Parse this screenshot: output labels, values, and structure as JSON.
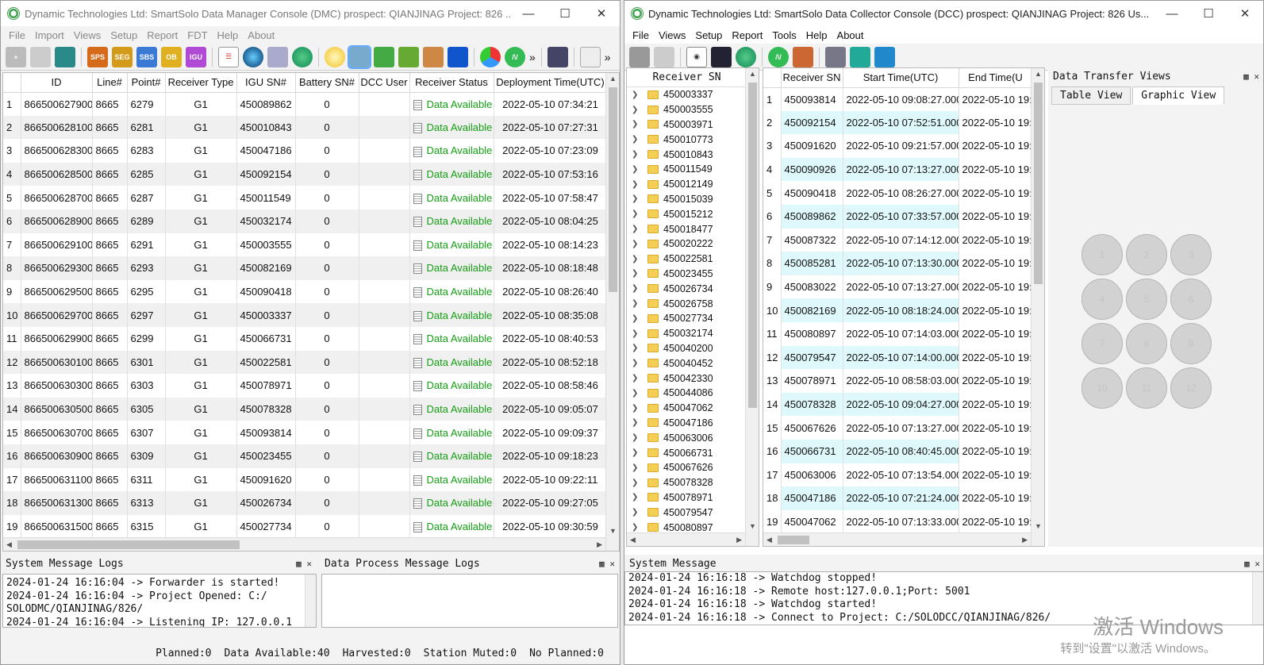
{
  "dmc": {
    "title": "Dynamic Technologies Ltd: SmartSolo Data Manager Console (DMC) prospect: QIANJINAG  Project: 826  ...",
    "menu": [
      "File",
      "Import",
      "Views",
      "Setup",
      "Report",
      "FDT",
      "Help",
      "About"
    ],
    "toolbar_labels": [
      "SPS",
      "SEG",
      "SBS",
      "OB",
      "IGU"
    ],
    "columns": [
      "ID",
      "Line#",
      "Point#",
      "Receiver Type",
      "IGU SN#",
      "Battery SN#",
      "DCC User",
      "Receiver Status",
      "Deployment Time(UTC)"
    ],
    "rows": [
      [
        "1",
        "866500627900",
        "8665",
        "6279",
        "G1",
        "450089862",
        "0",
        "",
        "Data Available",
        "2022-05-10 07:34:21"
      ],
      [
        "2",
        "866500628100",
        "8665",
        "6281",
        "G1",
        "450010843",
        "0",
        "",
        "Data Available",
        "2022-05-10 07:27:31"
      ],
      [
        "3",
        "866500628300",
        "8665",
        "6283",
        "G1",
        "450047186",
        "0",
        "",
        "Data Available",
        "2022-05-10 07:23:09"
      ],
      [
        "4",
        "866500628500",
        "8665",
        "6285",
        "G1",
        "450092154",
        "0",
        "",
        "Data Available",
        "2022-05-10 07:53:16"
      ],
      [
        "5",
        "866500628700",
        "8665",
        "6287",
        "G1",
        "450011549",
        "0",
        "",
        "Data Available",
        "2022-05-10 07:58:47"
      ],
      [
        "6",
        "866500628900",
        "8665",
        "6289",
        "G1",
        "450032174",
        "0",
        "",
        "Data Available",
        "2022-05-10 08:04:25"
      ],
      [
        "7",
        "866500629100",
        "8665",
        "6291",
        "G1",
        "450003555",
        "0",
        "",
        "Data Available",
        "2022-05-10 08:14:23"
      ],
      [
        "8",
        "866500629300",
        "8665",
        "6293",
        "G1",
        "450082169",
        "0",
        "",
        "Data Available",
        "2022-05-10 08:18:48"
      ],
      [
        "9",
        "866500629500",
        "8665",
        "6295",
        "G1",
        "450090418",
        "0",
        "",
        "Data Available",
        "2022-05-10 08:26:40"
      ],
      [
        "10",
        "866500629700",
        "8665",
        "6297",
        "G1",
        "450003337",
        "0",
        "",
        "Data Available",
        "2022-05-10 08:35:08"
      ],
      [
        "11",
        "866500629900",
        "8665",
        "6299",
        "G1",
        "450066731",
        "0",
        "",
        "Data Available",
        "2022-05-10 08:40:53"
      ],
      [
        "12",
        "866500630100",
        "8665",
        "6301",
        "G1",
        "450022581",
        "0",
        "",
        "Data Available",
        "2022-05-10 08:52:18"
      ],
      [
        "13",
        "866500630300",
        "8665",
        "6303",
        "G1",
        "450078971",
        "0",
        "",
        "Data Available",
        "2022-05-10 08:58:46"
      ],
      [
        "14",
        "866500630500",
        "8665",
        "6305",
        "G1",
        "450078328",
        "0",
        "",
        "Data Available",
        "2022-05-10 09:05:07"
      ],
      [
        "15",
        "866500630700",
        "8665",
        "6307",
        "G1",
        "450093814",
        "0",
        "",
        "Data Available",
        "2022-05-10 09:09:37"
      ],
      [
        "16",
        "866500630900",
        "8665",
        "6309",
        "G1",
        "450023455",
        "0",
        "",
        "Data Available",
        "2022-05-10 09:18:23"
      ],
      [
        "17",
        "866500631100",
        "8665",
        "6311",
        "G1",
        "450091620",
        "0",
        "",
        "Data Available",
        "2022-05-10 09:22:11"
      ],
      [
        "18",
        "866500631300",
        "8665",
        "6313",
        "G1",
        "450026734",
        "0",
        "",
        "Data Available",
        "2022-05-10 09:27:05"
      ],
      [
        "19",
        "866500631500",
        "8665",
        "6315",
        "G1",
        "450027734",
        "0",
        "",
        "Data Available",
        "2022-05-10 09:30:59"
      ]
    ],
    "system_log_title": "System Message Logs",
    "process_log_title": "Data Process Message Logs",
    "system_log": [
      "2024-01-24 16:16:04 -> Forwarder is started!",
      "2024-01-24 16:16:04 -> Project Opened: C:/",
      "SOLODMC/QIANJINAG/826/",
      "2024-01-24 16:16:04 -> Listening IP: 127.0.0.1"
    ],
    "status": [
      "Planned:0",
      "Data Available:40",
      "Harvested:0",
      "Station Muted:0",
      "No Planned:0"
    ]
  },
  "dcc": {
    "title": "Dynamic Technologies Ltd: SmartSolo Data Collector Console (DCC) prospect: QIANJINAG  Project: 826  Us...",
    "menu": [
      "File",
      "Views",
      "Setup",
      "Report",
      "Tools",
      "Help",
      "About"
    ],
    "tree_header": "Receiver SN",
    "tree": [
      "450003337",
      "450003555",
      "450003971",
      "450010773",
      "450010843",
      "450011549",
      "450012149",
      "450015039",
      "450015212",
      "450018477",
      "450020222",
      "450022581",
      "450023455",
      "450026734",
      "450026758",
      "450027734",
      "450032174",
      "450040200",
      "450040452",
      "450042330",
      "450044086",
      "450047062",
      "450047186",
      "450063006",
      "450066731",
      "450067626",
      "450078328",
      "450078971",
      "450079547",
      "450080897"
    ],
    "columns": [
      "Receiver SN",
      "Start Time(UTC)",
      "End Time(U"
    ],
    "rows": [
      [
        "1",
        "450093814",
        "2022-05-10 09:08:27.000",
        "2022-05-10 19:"
      ],
      [
        "2",
        "450092154",
        "2022-05-10 07:52:51.000",
        "2022-05-10 19:"
      ],
      [
        "3",
        "450091620",
        "2022-05-10 09:21:57.000",
        "2022-05-10 19:"
      ],
      [
        "4",
        "450090926",
        "2022-05-10 07:13:27.000",
        "2022-05-10 19:"
      ],
      [
        "5",
        "450090418",
        "2022-05-10 08:26:27.000",
        "2022-05-10 19:"
      ],
      [
        "6",
        "450089862",
        "2022-05-10 07:33:57.000",
        "2022-05-10 19:"
      ],
      [
        "7",
        "450087322",
        "2022-05-10 07:14:12.000",
        "2022-05-10 19:"
      ],
      [
        "8",
        "450085281",
        "2022-05-10 07:13:30.000",
        "2022-05-10 19:"
      ],
      [
        "9",
        "450083022",
        "2022-05-10 07:13:27.000",
        "2022-05-10 19:"
      ],
      [
        "10",
        "450082169",
        "2022-05-10 08:18:24.000",
        "2022-05-10 19:"
      ],
      [
        "11",
        "450080897",
        "2022-05-10 07:14:03.000",
        "2022-05-10 19:"
      ],
      [
        "12",
        "450079547",
        "2022-05-10 07:14:00.000",
        "2022-05-10 19:"
      ],
      [
        "13",
        "450078971",
        "2022-05-10 08:58:03.000",
        "2022-05-10 19:"
      ],
      [
        "14",
        "450078328",
        "2022-05-10 09:04:27.000",
        "2022-05-10 19:"
      ],
      [
        "15",
        "450067626",
        "2022-05-10 07:13:27.000",
        "2022-05-10 19:"
      ],
      [
        "16",
        "450066731",
        "2022-05-10 08:40:45.000",
        "2022-05-10 19:"
      ],
      [
        "17",
        "450063006",
        "2022-05-10 07:13:54.000",
        "2022-05-10 19:"
      ],
      [
        "18",
        "450047186",
        "2022-05-10 07:21:24.000",
        "2022-05-10 19:"
      ],
      [
        "19",
        "450047062",
        "2022-05-10 07:13:33.000",
        "2022-05-10 19:"
      ]
    ],
    "transfer_title": "Data Transfer Views",
    "tabs": [
      "Table View",
      "Graphic View"
    ],
    "slots": [
      "1",
      "2",
      "3",
      "4",
      "5",
      "6",
      "7",
      "8",
      "9",
      "10",
      "11",
      "12"
    ],
    "system_title": "System Message",
    "system_log": [
      "2024-01-24 16:16:18 -> Watchdog stopped!",
      "2024-01-24 16:16:18 -> Remote host:127.0.0.1;Port: 5001",
      "2024-01-24 16:16:18 -> Watchdog started!",
      "2024-01-24 16:16:18 -> Connect to Project: C:/SOLODCC/QIANJINAG/826/"
    ]
  },
  "watermark": {
    "line1": "激活 Windows",
    "line2": "转到\"设置\"以激活 Windows。"
  }
}
